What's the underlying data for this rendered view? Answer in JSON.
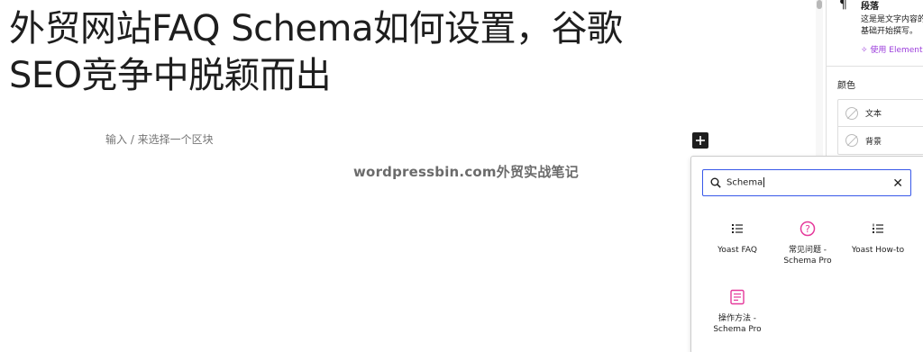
{
  "post": {
    "title_line1": "外贸网站FAQ Schema如何设置，谷歌",
    "title_line2": "SEO竞争中脱颖而出",
    "placeholder": "输入 / 来选择一个区块",
    "watermark": "wordpressbin.com外贸实战笔记"
  },
  "sidebar": {
    "block_icon": "paragraph-icon",
    "block_title": "段落",
    "block_desc_line1": "这是是文字内容的基",
    "block_desc_line2": "基础开始撰写。",
    "use_element_label": "使用 Element",
    "color_heading": "颜色",
    "color_text_label": "文本",
    "color_bg_label": "背景"
  },
  "inserter": {
    "search_value": "Schema",
    "results": [
      {
        "label": "Yoast FAQ",
        "icon": "list-icon"
      },
      {
        "label": "常见问题 -\nSchema Pro",
        "icon": "question-circle-icon"
      },
      {
        "label": "Yoast How-to",
        "icon": "ordered-list-icon"
      },
      {
        "label": "操作方法 -\nSchema Pro",
        "icon": "howto-doc-icon"
      }
    ]
  },
  "colors": {
    "accent": "#3858e9",
    "brand_pink": "#e5399b",
    "element_purple": "#9b3cdb"
  }
}
